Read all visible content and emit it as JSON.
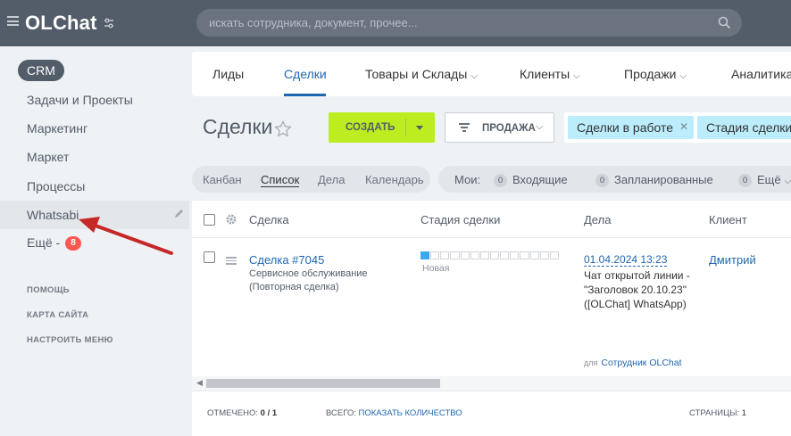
{
  "header": {
    "logo": "OLChat",
    "search_placeholder": "искать сотрудника, документ, прочее..."
  },
  "sidebar": {
    "crm_label": "CRM",
    "items": [
      {
        "label": "Задачи и Проекты"
      },
      {
        "label": "Маркетинг"
      },
      {
        "label": "Маркет"
      },
      {
        "label": "Процессы"
      },
      {
        "label": "Whatsabi"
      },
      {
        "label": "Ещё -",
        "badge": "8"
      }
    ],
    "links": [
      "ПОМОЩЬ",
      "КАРТА САЙТА",
      "НАСТРОИТЬ МЕНЮ"
    ]
  },
  "nav": {
    "tabs": [
      {
        "label": "Лиды"
      },
      {
        "label": "Сделки",
        "selected": true
      },
      {
        "label": "Товары и Склады",
        "dropdown": true
      },
      {
        "label": "Клиенты",
        "dropdown": true
      },
      {
        "label": "Продажи",
        "dropdown": true
      },
      {
        "label": "Аналитика"
      }
    ]
  },
  "toolbar": {
    "title": "Сделки",
    "create_label": "СОЗДАТЬ",
    "filter_label": "ПРОДАЖА",
    "chips": [
      "Сделки в работе",
      "Стадия сделки:"
    ]
  },
  "views": {
    "tabs": [
      "Канбан",
      "Список",
      "Дела",
      "Календарь"
    ],
    "selected": "Список"
  },
  "counters": {
    "label": "Мои:",
    "items": [
      {
        "count": "0",
        "label": "Входящие"
      },
      {
        "count": "0",
        "label": "Запланированные"
      },
      {
        "count": "0",
        "label": "Ещё"
      }
    ]
  },
  "grid": {
    "columns": [
      "Сделка",
      "Стадия сделки",
      "Дела",
      "Клиент"
    ],
    "rows": [
      {
        "deal": "Сделка #7045",
        "deal_sub": "Сервисное обслуживание (Повторная сделка)",
        "stage": "Новая",
        "stage_progress": 0.07,
        "activity_date": "01.04.2024 13:23",
        "activity_text": "Чат открытой линии - \"Заголовок 20.10.23\" ([OLChat] WhatsApp)",
        "activity_for_label": "для",
        "activity_for": "Сотрудник OLChat",
        "client": "Дмитрий"
      }
    ]
  },
  "footer": {
    "checked_label": "ОТМЕЧЕНО:",
    "checked_value": "0 / 1",
    "total_label": "ВСЕГО:",
    "total_link": "ПОКАЗАТЬ КОЛИЧЕСТВО",
    "pages_label": "СТРАНИЦЫ:",
    "pages_value": "1"
  },
  "colors": {
    "topbar": "#535c69",
    "accent_link": "#2067b0",
    "create_button": "#bbed21",
    "chip": "#bcedfc",
    "badge": "#ff5752",
    "annotation_arrow": "#c62828"
  }
}
